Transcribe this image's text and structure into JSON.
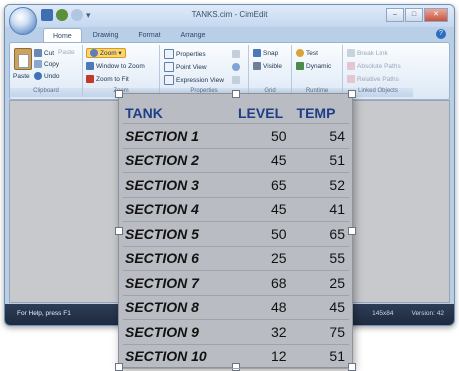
{
  "window": {
    "title": "TANKS.cim - CimEdit",
    "buttons": [
      "–",
      "□",
      "✕"
    ]
  },
  "ribbon": {
    "tabs": [
      "Home",
      "Drawing",
      "Format",
      "Arrange"
    ],
    "active_tab": "Home",
    "groups": {
      "clipboard": {
        "label": "Clipboard",
        "paste": "Paste",
        "cut": "Cut",
        "paste2": "Paste",
        "copy": "Copy",
        "undo": "Undo"
      },
      "zoom": {
        "label": "Zoom",
        "zoom": "Zoom ▾",
        "window_to_zoom": "Window to Zoom",
        "zoom_to_fit": "Zoom to Fit"
      },
      "properties": {
        "label": "Properties",
        "properties": "Properties",
        "point_view": "Point View",
        "expression_view": "Expression View"
      },
      "grid": {
        "label": "Grid",
        "snap": "Snap",
        "visible": "Visible"
      },
      "runtime": {
        "label": "Runtime",
        "test": "Test",
        "dynamic": "Dynamic"
      },
      "linked_objects": {
        "label": "Linked Objects",
        "break_link": "Break Link",
        "absolute_paths": "Absolute Paths",
        "relative_paths": "Relative Paths"
      }
    }
  },
  "status": {
    "help": "For Help, press F1",
    "size": "145x84",
    "version": "Version: 42"
  },
  "tank_table": {
    "headers": [
      "TANK",
      "LEVEL",
      "TEMP"
    ],
    "rows": [
      [
        "SECTION 1",
        "50",
        "54"
      ],
      [
        "SECTION 2",
        "45",
        "51"
      ],
      [
        "SECTION 3",
        "65",
        "52"
      ],
      [
        "SECTION 4",
        "45",
        "41"
      ],
      [
        "SECTION 5",
        "50",
        "65"
      ],
      [
        "SECTION 6",
        "25",
        "55"
      ],
      [
        "SECTION 7",
        "68",
        "25"
      ],
      [
        "SECTION 8",
        "48",
        "45"
      ],
      [
        "SECTION 9",
        "32",
        "75"
      ],
      [
        "SECTION 10",
        "12",
        "51"
      ]
    ]
  },
  "colors": {
    "header_text": "#1e3f87",
    "panel_bg": "#b9bcc2",
    "status_bg": "#1e2a3f"
  }
}
